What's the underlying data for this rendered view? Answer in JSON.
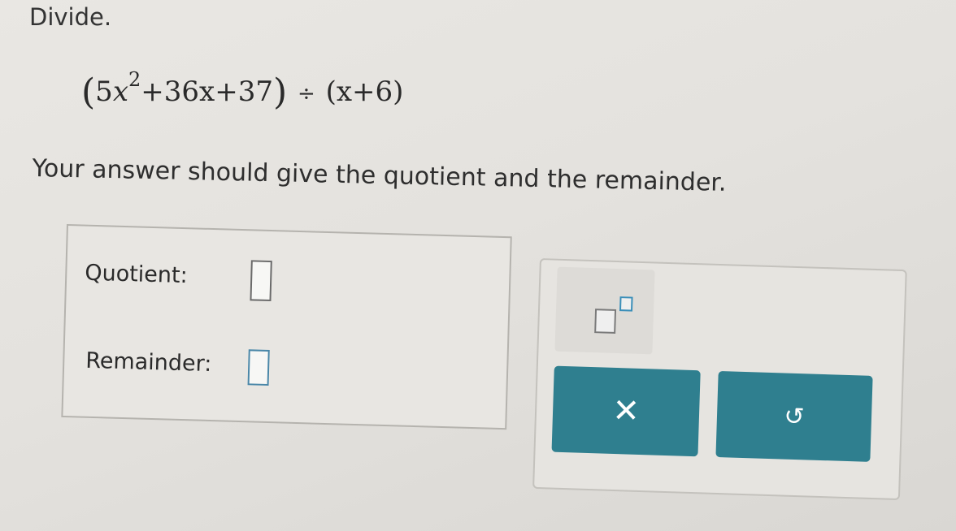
{
  "prompt": "Divide.",
  "problem": {
    "open_paren": "(",
    "leading_coef": "5",
    "variable": "x",
    "exponent": "2",
    "rest_of_dividend": "+36x+37",
    "close_paren": ")",
    "divide_sign": "÷",
    "divisor": "(x+6)"
  },
  "instruction": "Your answer should give the quotient and the remainder.",
  "answer": {
    "quotient_label": "Quotient:",
    "quotient_value": "",
    "remainder_label": "Remainder:",
    "remainder_value": ""
  },
  "toolbar": {
    "superscript_icon": "superscript-template-icon",
    "clear_glyph": "✕",
    "undo_glyph": "↺",
    "accent_color": "#2f7f8f"
  }
}
